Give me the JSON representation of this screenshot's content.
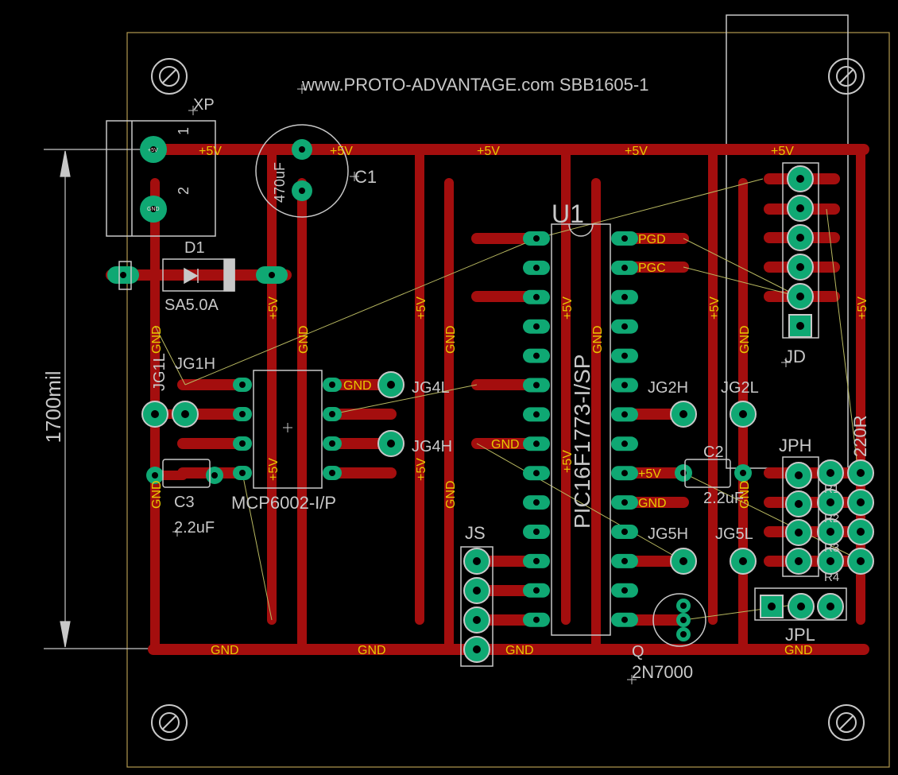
{
  "board": {
    "title": "www.PROTO-ADVANTAGE.com SBB1605-1",
    "dimension_label": "1700mil"
  },
  "colors": {
    "background": "#000000",
    "top_copper": "#a40e0e",
    "pad": "#0fa873",
    "silkscreen": "#c8c8c8",
    "outline": "#b29a50",
    "net_label": "#e8c800",
    "ratsnest": "#b8b860"
  },
  "components": {
    "xp": "XP",
    "xp_pin1": "1",
    "xp_pin2": "2",
    "c1": "C1",
    "c1_value": "470uF",
    "d1": "D1",
    "d1_value": "SA5.0A",
    "u1": "U1",
    "u1_value": "PIC16F1773-I/SP",
    "jd": "JD",
    "jg1h": "JG1H",
    "jg1l": "JG1L",
    "jg4l": "JG4L",
    "jg4h": "JG4H",
    "jg2h": "JG2H",
    "jg2l": "JG2L",
    "jg5h": "JG5H",
    "jg5l": "JG5L",
    "c2": "C2",
    "c2_value": "2.2uF",
    "c3": "C3",
    "c3_value": "2.2uF",
    "mcp": "MCP6002-I/P",
    "js": "JS",
    "jph": "JPH",
    "jpl": "JPL",
    "r1": "R1",
    "r2": "R2",
    "r3": "R3",
    "r4": "R4",
    "r_value": "220R",
    "q": "Q",
    "q_value": "2N7000"
  },
  "nets": {
    "vcc": "+5V",
    "gnd": "GND",
    "pgd": "PGD",
    "pgc": "PGC",
    "pad_vcc": "+5V",
    "pad_gnd": "GND"
  }
}
